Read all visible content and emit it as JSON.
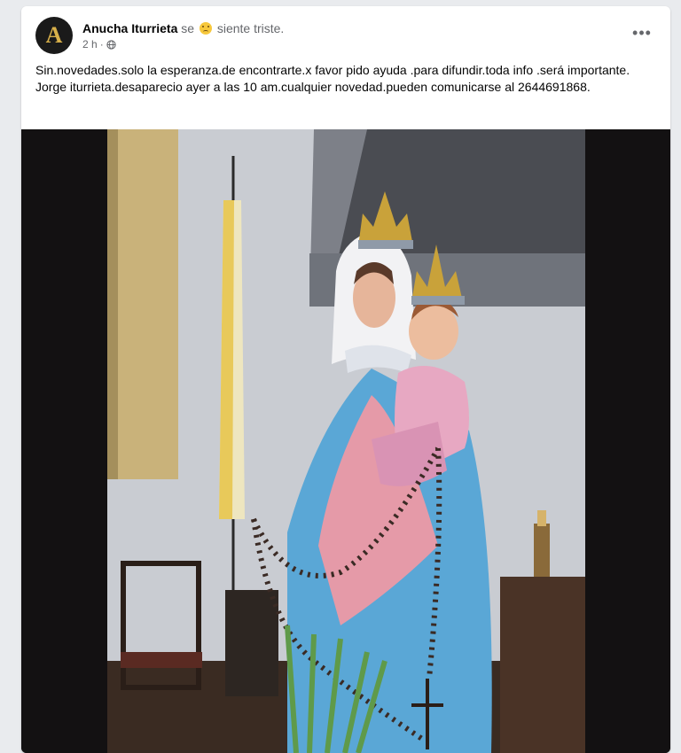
{
  "post": {
    "avatar_letter": "A",
    "author": "Anucha Iturrieta",
    "feeling_prefix": "se",
    "feeling_icon": "sad-face-icon",
    "feeling_text": "siente triste.",
    "time": "2 h",
    "time_separator": "·",
    "audience_icon": "globe-icon",
    "more_icon": "more-options-icon",
    "more_label": "•••",
    "text": "Sin.novedades.solo la esperanza.de encontrarte.x favor pido ayuda .para difundir.toda info .será importante. Jorge iturrieta.desaparecio ayer a las 10 am.cualquier novedad.pueden comunicarse al 2644691868."
  },
  "colors": {
    "background": "#e9ebee",
    "card": "#ffffff",
    "text_primary": "#050505",
    "text_secondary": "#65676b"
  }
}
